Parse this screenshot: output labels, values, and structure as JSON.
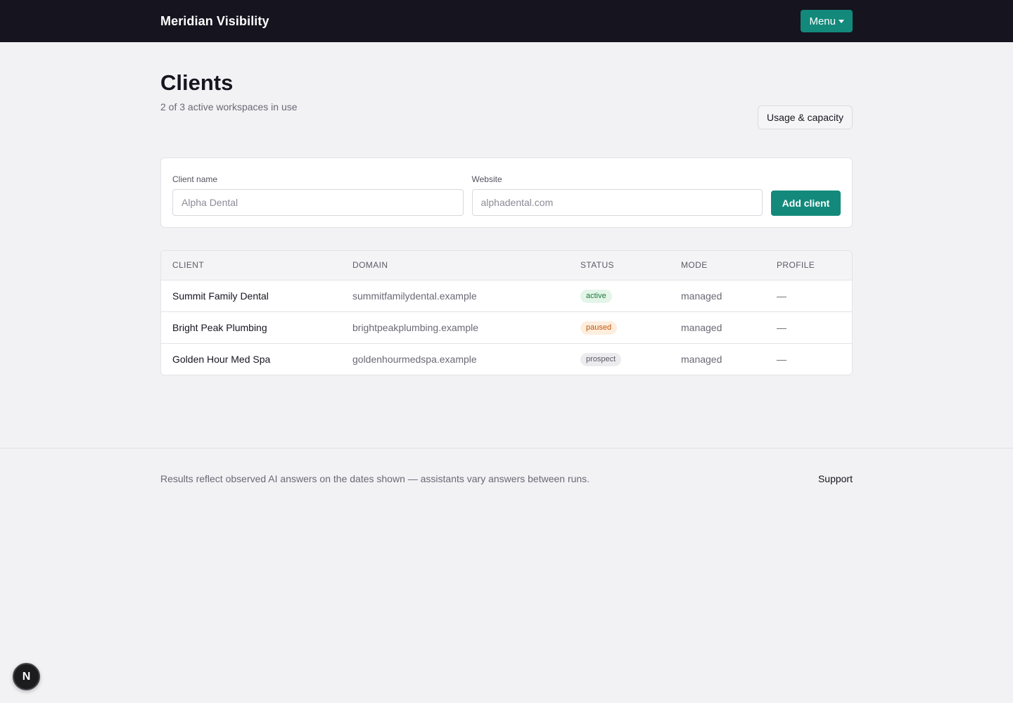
{
  "header": {
    "brand": "Meridian Visibility",
    "menu_label": "Menu"
  },
  "page": {
    "title": "Clients",
    "subtitle": "2 of 3 active workspaces in use",
    "usage_button": "Usage & capacity"
  },
  "form": {
    "client_name_label": "Client name",
    "client_name_placeholder": "Alpha Dental",
    "website_label": "Website",
    "website_placeholder": "alphadental.com",
    "add_button": "Add client"
  },
  "table": {
    "headers": [
      "CLIENT",
      "DOMAIN",
      "STATUS",
      "MODE",
      "PROFILE"
    ],
    "rows": [
      {
        "client": "Summit Family Dental",
        "domain": "summitfamilydental.example",
        "status": "active",
        "mode": "managed",
        "profile": "—"
      },
      {
        "client": "Bright Peak Plumbing",
        "domain": "brightpeakplumbing.example",
        "status": "paused",
        "mode": "managed",
        "profile": "—"
      },
      {
        "client": "Golden Hour Med Spa",
        "domain": "goldenhourmedspa.example",
        "status": "prospect",
        "mode": "managed",
        "profile": "—"
      }
    ]
  },
  "status_colors": {
    "active": {
      "bg": "#e3f5e8",
      "fg": "#1e7a3c"
    },
    "paused": {
      "bg": "#fdeedd",
      "fg": "#c0560f"
    },
    "prospect": {
      "bg": "#ececef",
      "fg": "#5d5a66"
    }
  },
  "footer": {
    "note": "Results reflect observed AI answers on the dates shown — assistants vary answers between runs.",
    "support": "Support"
  },
  "dev_badge": {
    "letter": "N"
  },
  "colors": {
    "accent": "#13897b",
    "topbar": "#16141f"
  }
}
